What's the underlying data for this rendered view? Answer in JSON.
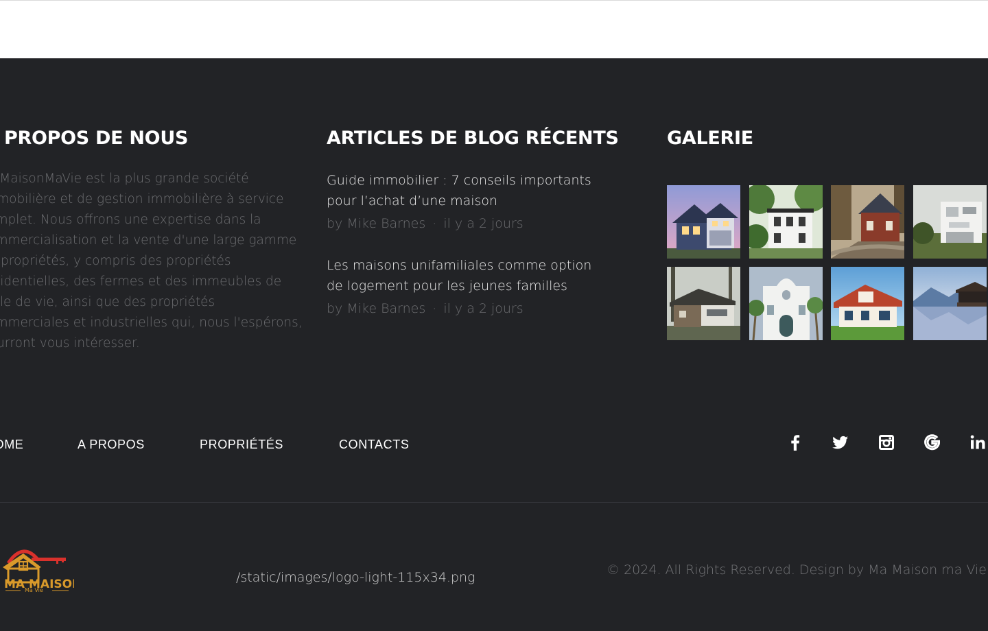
{
  "about": {
    "title": "PROPOS DE NOUS",
    "text": "MaMaisonMaVie est la plus grande société immobilière et de gestion immobilière à service complet. Nous offrons une expertise dans la commercialisation et la vente d'une large gamme de propriétés, y compris des propriétés résidentielles, des fermes et des immeubles de style de vie, ainsi que des propriétés commerciales et industrielles qui, nous l'espérons, pourront vous intéresser."
  },
  "blog": {
    "title": "ARTICLES DE BLOG RÉCENTS",
    "posts": [
      {
        "title": "Guide immobilier : 7 conseils importants pour l’achat d’une maison",
        "author": "by Mike Barnes",
        "separator": "·",
        "date": "il y a 2 jours"
      },
      {
        "title": "Les maisons unifamiliales comme option de logement pour les jeunes familles",
        "author": "by Mike Barnes",
        "separator": "·",
        "date": "il y a 2 jours"
      }
    ]
  },
  "gallery": {
    "title": "GALERIE",
    "images": [
      "house-dusk-image",
      "white-house-trees-image",
      "red-brick-house-image",
      "modern-white-house-image",
      "stone-house-forest-image",
      "white-mediterranean-house-image",
      "red-roof-villa-image",
      "lake-house-mountains-image"
    ]
  },
  "nav": {
    "items": [
      "HOME",
      "A PROPOS",
      "PROPRIÉTÉS",
      "CONTACTS"
    ]
  },
  "social": {
    "icons": [
      "facebook-icon",
      "twitter-icon",
      "instagram-icon",
      "google-icon",
      "linkedin-icon"
    ]
  },
  "bottom": {
    "logo_text": "MA MAISON",
    "logo_subtext": "Ma Vie",
    "logo_path": "/static/images/logo-light-115x34.png",
    "copyright": "© 2024. All Rights Reserved. Design by Ma Maison ma Vie"
  },
  "colors": {
    "background": "#222326",
    "header": "#ffffff",
    "logo_red": "#d9312c",
    "logo_gold": "#d99a2b"
  }
}
